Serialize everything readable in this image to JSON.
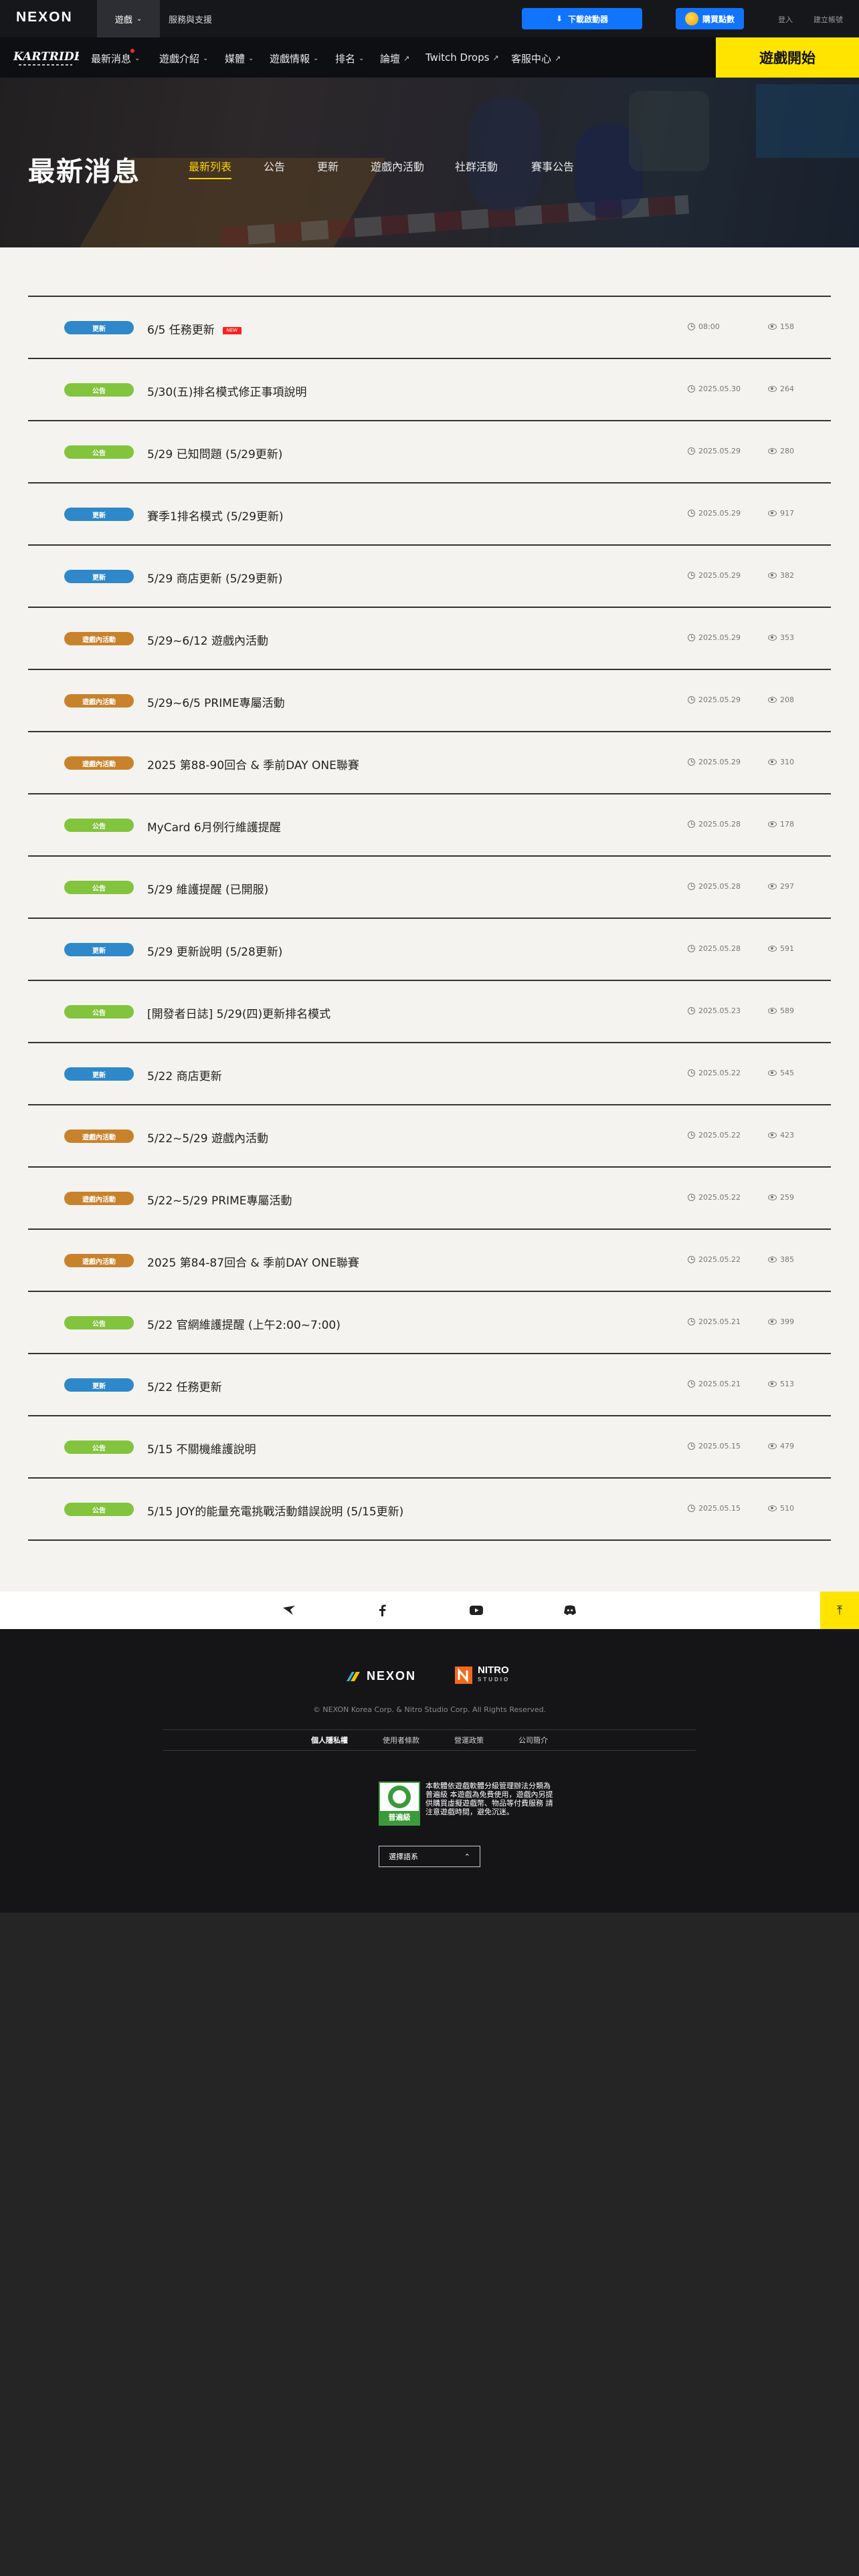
{
  "topbar": {
    "brand": "NEXON",
    "game_label": "遊戲",
    "service_label": "服務與支援",
    "download_label": "下載啟動器",
    "points_label": "購買點數",
    "login_label": "登入",
    "register_label": "建立帳號"
  },
  "gamenav": {
    "logo_text": "KARTRIDER",
    "items": [
      {
        "label": "最新消息"
      },
      {
        "label": "遊戲介紹"
      },
      {
        "label": "媒體"
      },
      {
        "label": "遊戲情報"
      },
      {
        "label": "排名"
      },
      {
        "label": "論壇"
      },
      {
        "label": "Twitch Drops"
      },
      {
        "label": "客服中心"
      }
    ],
    "start_label": "遊戲開始"
  },
  "hero": {
    "title": "最新消息",
    "tabs": [
      {
        "label": "最新列表",
        "active": true
      },
      {
        "label": "公告"
      },
      {
        "label": "更新"
      },
      {
        "label": "遊戲內活動"
      },
      {
        "label": "社群活動"
      },
      {
        "label": "賽事公告"
      }
    ]
  },
  "news": [
    {
      "category": "更新",
      "type": "update",
      "title": "6/5 任務更新",
      "is_new": true,
      "new_label": "NEW",
      "date": "08:00",
      "views": "158"
    },
    {
      "category": "公告",
      "type": "notice",
      "title": "5/30(五)排名模式修正事項說明",
      "date": "2025.05.30",
      "views": "264"
    },
    {
      "category": "公告",
      "type": "notice",
      "title": "5/29 已知問題 (5/29更新)",
      "date": "2025.05.29",
      "views": "280"
    },
    {
      "category": "更新",
      "type": "update",
      "title": "賽季1排名模式 (5/29更新)",
      "date": "2025.05.29",
      "views": "917"
    },
    {
      "category": "更新",
      "type": "update",
      "title": "5/29 商店更新 (5/29更新)",
      "date": "2025.05.29",
      "views": "382"
    },
    {
      "category": "遊戲內活動",
      "type": "event",
      "title": "5/29~6/12 遊戲內活動",
      "date": "2025.05.29",
      "views": "353"
    },
    {
      "category": "遊戲內活動",
      "type": "event",
      "title": "5/29~6/5 PRIME專屬活動",
      "date": "2025.05.29",
      "views": "208"
    },
    {
      "category": "遊戲內活動",
      "type": "event",
      "title": "2025 第88-90回合 & 季前DAY ONE聯賽",
      "date": "2025.05.29",
      "views": "310"
    },
    {
      "category": "公告",
      "type": "notice",
      "title": "MyCard 6月例行維護提醒",
      "date": "2025.05.28",
      "views": "178"
    },
    {
      "category": "公告",
      "type": "notice",
      "title": "5/29 維護提醒 (已開服)",
      "date": "2025.05.28",
      "views": "297"
    },
    {
      "category": "更新",
      "type": "update",
      "title": "5/29 更新說明 (5/28更新)",
      "date": "2025.05.28",
      "views": "591"
    },
    {
      "category": "公告",
      "type": "notice",
      "title": "[開發者日誌] 5/29(四)更新排名模式",
      "date": "2025.05.23",
      "views": "589"
    },
    {
      "category": "更新",
      "type": "update",
      "title": "5/22 商店更新",
      "date": "2025.05.22",
      "views": "545"
    },
    {
      "category": "遊戲內活動",
      "type": "event",
      "title": "5/22~5/29 遊戲內活動",
      "date": "2025.05.22",
      "views": "423"
    },
    {
      "category": "遊戲內活動",
      "type": "event",
      "title": "5/22~5/29 PRIME專屬活動",
      "date": "2025.05.22",
      "views": "259"
    },
    {
      "category": "遊戲內活動",
      "type": "event",
      "title": "2025 第84-87回合 & 季前DAY ONE聯賽",
      "date": "2025.05.22",
      "views": "385"
    },
    {
      "category": "公告",
      "type": "notice",
      "title": "5/22 官網維護提醒 (上午2:00~7:00)",
      "date": "2025.05.21",
      "views": "399"
    },
    {
      "category": "更新",
      "type": "update",
      "title": "5/22 任務更新",
      "date": "2025.05.21",
      "views": "513"
    },
    {
      "category": "公告",
      "type": "notice",
      "title": "5/15 不關機維護說明",
      "date": "2025.05.15",
      "views": "479"
    },
    {
      "category": "公告",
      "type": "notice",
      "title": "5/15 JOY的能量充電挑戰活動錯誤說明 (5/15更新)",
      "date": "2025.05.15",
      "views": "510"
    }
  ],
  "social": {
    "icons": [
      "kartrider-icon",
      "facebook-icon",
      "youtube-icon",
      "discord-icon"
    ]
  },
  "footer": {
    "nexon": "NEXON",
    "nitro": "NITRO",
    "nitro_sub": "STUDIO",
    "copyright": "© NEXON Korea Corp. & Nitro Studio Corp. All Rights Reserved.",
    "links": [
      {
        "label": "個人隱私權",
        "bold": true
      },
      {
        "label": "使用者條款"
      },
      {
        "label": "營運政策"
      },
      {
        "label": "公司簡介"
      }
    ],
    "rating_label": "普遍級",
    "rating_text": "本軟體依遊戲軟體分級管理辦法分類為 普遍級 本遊戲為免費使用，遊戲內另提供購買虛擬遊戲幣、物品等付費服務 請注意遊戲時間，避免沉迷。",
    "region_label": "選擇語系"
  },
  "colors": {
    "update": "#2e88c9",
    "notice": "#82c43d",
    "event": "#c8822c",
    "accent_yellow": "#ffe400",
    "primary_blue": "#1074ff"
  }
}
